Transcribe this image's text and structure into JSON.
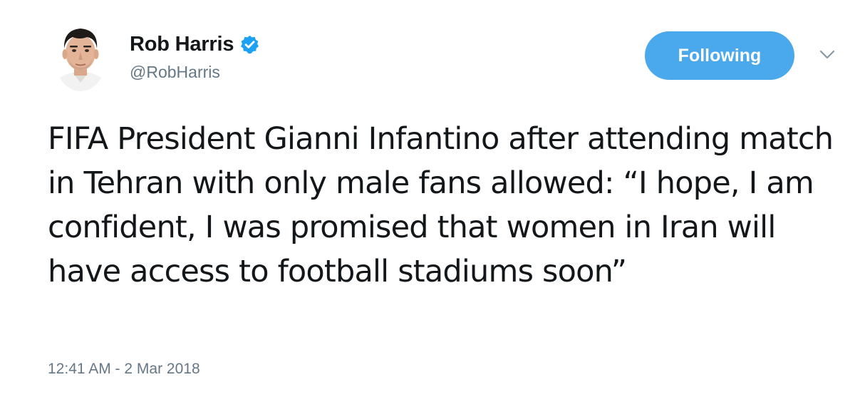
{
  "tweet": {
    "author": {
      "display_name": "Rob Harris",
      "handle": "@RobHarris",
      "verified": true
    },
    "follow_button_label": "Following",
    "text": "FIFA President Gianni Infantino after attending match in Tehran with only male fans allowed: “I hope, I am confident, I was promised that women in Iran will have access to football stadiums soon”",
    "timestamp": "12:41 AM - 2 Mar 2018"
  },
  "icons": {
    "verified": "verified-badge-icon",
    "caret": "chevron-down-icon"
  },
  "colors": {
    "accent": "#4aa8ec",
    "verified_blue": "#1da1f2",
    "secondary_text": "#657786",
    "primary_text": "#14171a"
  }
}
